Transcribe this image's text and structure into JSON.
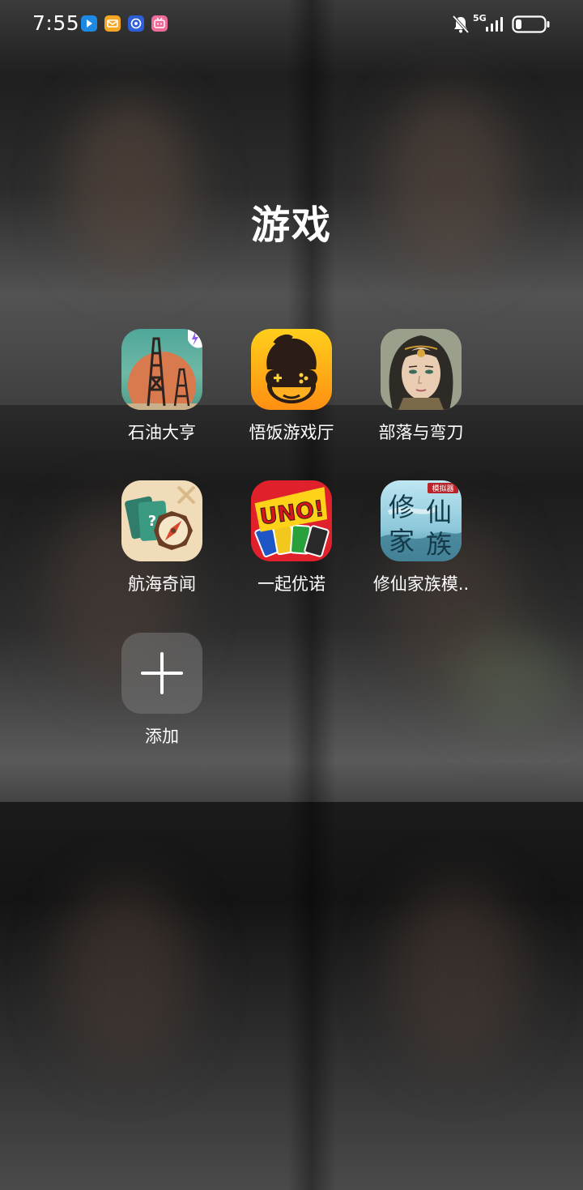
{
  "status_bar": {
    "time": "7:55",
    "notifications": [
      "direction-app-icon",
      "mail-app-icon",
      "browser-app-icon",
      "bilibili-app-icon"
    ],
    "network": "5G",
    "network_sub": "5G",
    "battery_level": 0.2
  },
  "folder": {
    "title": "游戏",
    "apps": [
      {
        "label": "石油大亨",
        "icon": "oil-rig-icon"
      },
      {
        "label": "悟饭游戏厅",
        "icon": "monkey-gamepad-icon"
      },
      {
        "label": "部落与弯刀",
        "icon": "warrior-portrait-icon"
      },
      {
        "label": "航海奇闻",
        "icon": "compass-cards-icon"
      },
      {
        "label": "一起优诺",
        "icon": "uno-cards-icon"
      },
      {
        "label": "修仙家族模..",
        "icon": "xiuxian-calligraphy-icon"
      }
    ],
    "add_label": "添加"
  },
  "icon_texts": {
    "uno": "UNO!",
    "xiuxian": [
      "修",
      "仙",
      "家",
      "族"
    ],
    "xiuxian_tag": "模拟器",
    "cards_mark": "?"
  }
}
